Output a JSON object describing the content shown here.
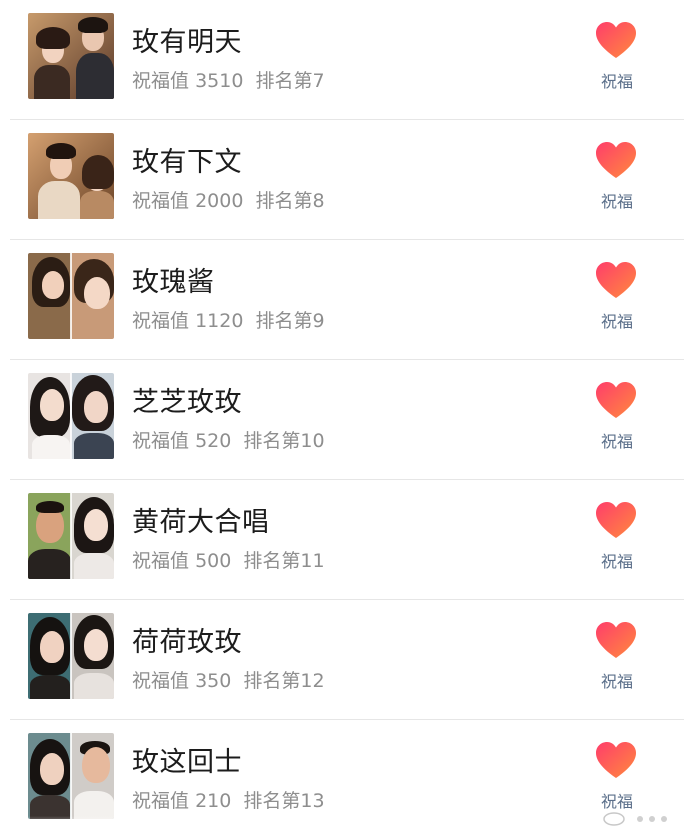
{
  "items": [
    {
      "title": "玫有明天",
      "bless_label": "祝福值",
      "bless_value": "3510",
      "rank_text": "排名第7",
      "action": "祝福"
    },
    {
      "title": "玫有下文",
      "bless_label": "祝福值",
      "bless_value": "2000",
      "rank_text": "排名第8",
      "action": "祝福"
    },
    {
      "title": "玫瑰酱",
      "bless_label": "祝福值",
      "bless_value": "1120",
      "rank_text": "排名第9",
      "action": "祝福"
    },
    {
      "title": "芝芝玫玫",
      "bless_label": "祝福值",
      "bless_value": "520",
      "rank_text": "排名第10",
      "action": "祝福"
    },
    {
      "title": "黄荷大合唱",
      "bless_label": "祝福值",
      "bless_value": "500",
      "rank_text": "排名第11",
      "action": "祝福"
    },
    {
      "title": "荷荷玫玫",
      "bless_label": "祝福值",
      "bless_value": "350",
      "rank_text": "排名第12",
      "action": "祝福"
    },
    {
      "title": "玫这回士",
      "bless_label": "祝福值",
      "bless_value": "210",
      "rank_text": "排名第13",
      "action": "祝福"
    }
  ],
  "colors": {
    "heart_start": "#ff3d6b",
    "heart_end": "#ff8a3d",
    "action_text": "#5b6f8a",
    "subtitle_text": "#8e8e8e",
    "title_text": "#1c1c1c"
  },
  "icons": {
    "heart": "heart-icon"
  }
}
